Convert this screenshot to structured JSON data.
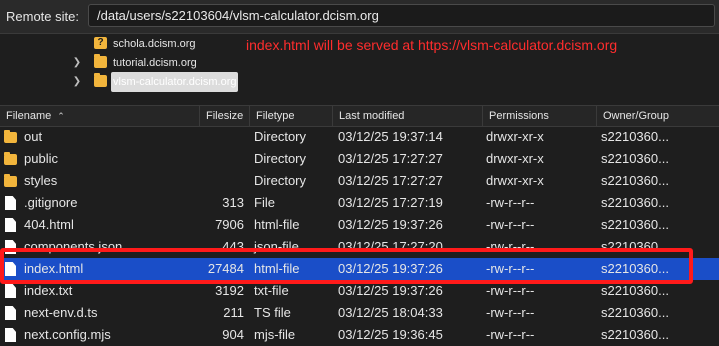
{
  "site_bar": {
    "label": "Remote site:",
    "path": "/data/users/s22103604/vlsm-calculator.dcism.org"
  },
  "tree": [
    {
      "label": "schola.dcism.org",
      "icon": "unknown-folder-icon",
      "expandable": false,
      "selected": false
    },
    {
      "label": "tutorial.dcism.org",
      "icon": "folder-icon",
      "expandable": true,
      "selected": false
    },
    {
      "label": "vlsm-calculator.dcism.org",
      "icon": "folder-icon",
      "expandable": true,
      "selected": true
    }
  ],
  "annotation": "index.html will be served at https://vlsm-calculator.dcism.org",
  "columns": {
    "filename": "Filename",
    "filesize": "Filesize",
    "filetype": "Filetype",
    "modified": "Last modified",
    "permissions": "Permissions",
    "owner": "Owner/Group"
  },
  "sort_indicator": "ascending",
  "files": [
    {
      "name": "out",
      "size": "",
      "type": "Directory",
      "modified": "03/12/25 19:37:14",
      "perms": "drwxr-xr-x",
      "owner": "s2210360...",
      "icon": "folder-icon"
    },
    {
      "name": "public",
      "size": "",
      "type": "Directory",
      "modified": "03/12/25 17:27:27",
      "perms": "drwxr-xr-x",
      "owner": "s2210360...",
      "icon": "folder-icon"
    },
    {
      "name": "styles",
      "size": "",
      "type": "Directory",
      "modified": "03/12/25 17:27:27",
      "perms": "drwxr-xr-x",
      "owner": "s2210360...",
      "icon": "folder-icon"
    },
    {
      "name": ".gitignore",
      "size": "313",
      "type": "File",
      "modified": "03/12/25 17:27:19",
      "perms": "-rw-r--r--",
      "owner": "s2210360...",
      "icon": "file-icon"
    },
    {
      "name": "404.html",
      "size": "7906",
      "type": "html-file",
      "modified": "03/12/25 19:37:26",
      "perms": "-rw-r--r--",
      "owner": "s2210360...",
      "icon": "file-icon"
    },
    {
      "name": "components.json",
      "size": "443",
      "type": "json-file",
      "modified": "03/12/25 17:27:20",
      "perms": "-rw-r--r--",
      "owner": "s2210360...",
      "icon": "file-icon"
    },
    {
      "name": "index.html",
      "size": "27484",
      "type": "html-file",
      "modified": "03/12/25 19:37:26",
      "perms": "-rw-r--r--",
      "owner": "s2210360...",
      "icon": "file-icon",
      "selected": true
    },
    {
      "name": "index.txt",
      "size": "3192",
      "type": "txt-file",
      "modified": "03/12/25 19:37:26",
      "perms": "-rw-r--r--",
      "owner": "s2210360...",
      "icon": "file-icon"
    },
    {
      "name": "next-env.d.ts",
      "size": "211",
      "type": "TS file",
      "modified": "03/12/25 18:04:33",
      "perms": "-rw-r--r--",
      "owner": "s2210360...",
      "icon": "file-icon"
    },
    {
      "name": "next.config.mjs",
      "size": "904",
      "type": "mjs-file",
      "modified": "03/12/25 19:36:45",
      "perms": "-rw-r--r--",
      "owner": "s2210360...",
      "icon": "file-icon"
    }
  ],
  "colors": {
    "selection": "#1a4ec8",
    "highlight_box": "#ff1a1a",
    "annotation": "#ff2d2d",
    "folder": "#f2b53c"
  }
}
